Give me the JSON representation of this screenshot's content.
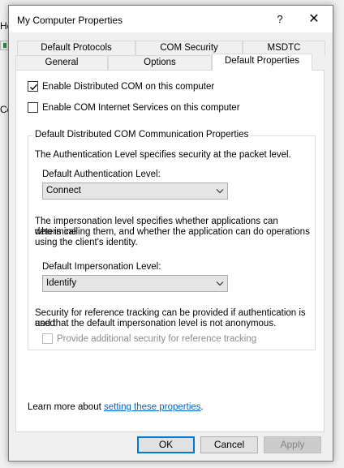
{
  "background": {
    "fragment_top": "He",
    "fragment_mid": "Co"
  },
  "window": {
    "title": "My Computer Properties",
    "help_label": "?",
    "close_label": "✕"
  },
  "tabs": {
    "row_back": [
      "Default Protocols",
      "COM Security",
      "MSDTC"
    ],
    "row_front": [
      "General",
      "Options",
      "Default Properties"
    ],
    "active": "Default Properties"
  },
  "panel": {
    "enable_dcom": {
      "label": "Enable Distributed COM on this computer",
      "checked": true
    },
    "enable_cis": {
      "label": "Enable COM Internet Services on this computer",
      "checked": false
    },
    "group": {
      "title": "Default Distributed COM Communication Properties",
      "auth_desc": "The Authentication Level specifies security at the packet level.",
      "auth_label": "Default Authentication Level:",
      "auth_value": "Connect",
      "imp_desc_1": "The impersonation level specifies whether applications can determine",
      "imp_desc_2": "who is calling them, and whether the application can do operations",
      "imp_desc_3": "using the client's identity.",
      "imp_label": "Default Impersonation Level:",
      "imp_value": "Identify",
      "ref_desc_1": "Security for reference tracking can be provided if authentication is used",
      "ref_desc_2": "and that the default impersonation level is not anonymous.",
      "ref_checkbox": {
        "label": "Provide additional security for reference tracking",
        "checked": false,
        "disabled": true
      }
    },
    "learn_more_prefix": "Learn more about ",
    "learn_more_link": "setting these properties",
    "learn_more_suffix": "."
  },
  "buttons": {
    "ok": "OK",
    "cancel": "Cancel",
    "apply": "Apply"
  },
  "colors": {
    "link": "#0066cc",
    "focus": "#0078d7"
  }
}
